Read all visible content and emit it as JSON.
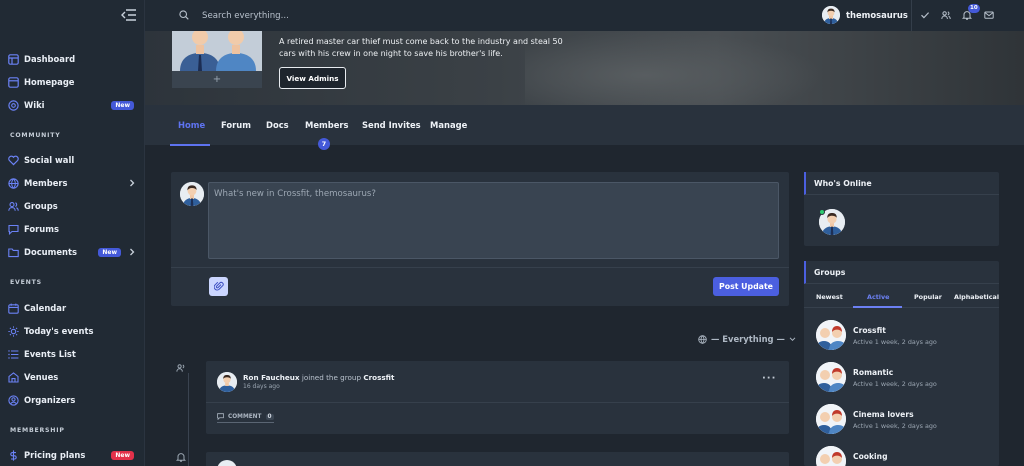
{
  "sidebar": {
    "items": [
      {
        "label": "Dashboard",
        "icon": "dashboard-icon"
      },
      {
        "label": "Homepage",
        "icon": "homepage-icon"
      },
      {
        "label": "Wiki",
        "icon": "wiki-icon",
        "badge": "New"
      },
      {
        "label": "Social wall",
        "icon": "heart-icon"
      },
      {
        "label": "Members",
        "icon": "globe-icon"
      },
      {
        "label": "Groups",
        "icon": "users-icon"
      },
      {
        "label": "Forums",
        "icon": "forum-icon"
      },
      {
        "label": "Documents",
        "icon": "folder-icon",
        "badge": "New"
      },
      {
        "label": "Calendar",
        "icon": "calendar-icon"
      },
      {
        "label": "Today's events",
        "icon": "sun-icon"
      },
      {
        "label": "Events List",
        "icon": "list-icon"
      },
      {
        "label": "Venues",
        "icon": "venue-icon"
      },
      {
        "label": "Organizers",
        "icon": "organizer-icon"
      },
      {
        "label": "Pricing plans",
        "icon": "dollar-icon",
        "badge": "New"
      }
    ],
    "sections": [
      "COMMUNITY",
      "EVENTS",
      "MEMBERSHIP"
    ]
  },
  "topbar": {
    "search_placeholder": "Search everything...",
    "username": "themosaurus",
    "notification_count": "10"
  },
  "cover": {
    "description": "A retired master car thief must come back to the industry and steal 50 cars with his crew in one night to save his brother's life.",
    "view_admins": "View Admins",
    "add_photo": "+"
  },
  "tabs": [
    {
      "label": "Home"
    },
    {
      "label": "Forum"
    },
    {
      "label": "Docs"
    },
    {
      "label": "Members"
    },
    {
      "label": "Send Invites"
    },
    {
      "label": "Manage"
    }
  ],
  "members_count": "7",
  "composer": {
    "placeholder": "What's new in Crossfit, themosaurus?",
    "post_label": "Post Update"
  },
  "filter": {
    "label": "— Everything —"
  },
  "activity": {
    "user": "Ron Faucheux",
    "action": "joined the group",
    "group": "Crossfit",
    "time": "16 days ago",
    "comment_label": "COMMENT",
    "comment_count": "0",
    "more": "···"
  },
  "widgets": {
    "online_title": "Who's Online",
    "groups_title": "Groups",
    "group_tabs": [
      "Newest",
      "Active",
      "Popular",
      "Alphabetical"
    ],
    "groups": [
      {
        "name": "Crossfit",
        "meta": "Active 1 week, 2 days ago"
      },
      {
        "name": "Romantic",
        "meta": "Active 1 week, 2 days ago"
      },
      {
        "name": "Cinema lovers",
        "meta": "Active 1 week, 2 days ago"
      },
      {
        "name": "Cooking",
        "meta": ""
      }
    ]
  },
  "colors": {
    "accent": "#4b5fe0",
    "badge_new_blue": "#4459d8",
    "badge_new_red": "#e2314a",
    "online": "#2ecc71"
  }
}
